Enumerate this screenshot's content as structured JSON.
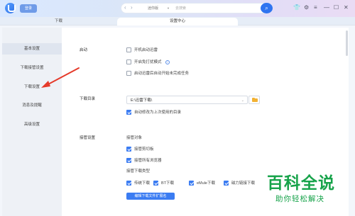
{
  "titlebar": {
    "login_label": "登录",
    "nav_back": "‹",
    "nav_forward": "›",
    "search_tag": "迷你版",
    "search_placeholder": "去搜索",
    "search_icon": "search-icon",
    "window_buttons": [
      "👕",
      "⚙",
      "≡",
      "—",
      "☐",
      "✕"
    ]
  },
  "tabs": {
    "download": "下载",
    "settings": "设置中心"
  },
  "sidebar": {
    "items": [
      {
        "label": "基本设置",
        "active": true
      },
      {
        "label": "下载接管设置",
        "active": false
      },
      {
        "label": "下载设置",
        "active": false
      },
      {
        "label": "消息及提醒",
        "active": false
      },
      {
        "label": "高级设置",
        "active": false
      }
    ]
  },
  "startup": {
    "label": "启动",
    "options": [
      {
        "text": "开机启动迅雷",
        "checked": false
      },
      {
        "text": "开启免打扰模式",
        "checked": false,
        "info_icon": "info-icon"
      },
      {
        "text": "启动迅雷后自动开始未完成任务",
        "checked": false
      }
    ]
  },
  "download_dir": {
    "label": "下载目录",
    "value": "E:\\迅雷下载\\",
    "caret": "⌄",
    "folder_icon": "folder-icon",
    "auto_modify_text": "自动修改为上次使用的目录",
    "auto_modify_checked": true
  },
  "takeover": {
    "label": "接管设置",
    "object_label": "接管对象",
    "objects": [
      {
        "text": "接管剪切板",
        "checked": true
      },
      {
        "text": "接管所有浏览器",
        "checked": true
      }
    ],
    "type_label": "接管下载类型",
    "types": [
      {
        "text": "传统下载",
        "checked": true
      },
      {
        "text": "BT下载",
        "checked": true
      },
      {
        "text": "eMule下载",
        "checked": true
      },
      {
        "text": "磁力链接下载",
        "checked": true
      }
    ],
    "extension_button": "编辑下载文件扩展名"
  },
  "watermark": {
    "title": "百科全说",
    "subtitle": "助你轻松解决"
  },
  "colors": {
    "accent": "#3b7cf2",
    "annotation_arrow": "#e53a2a",
    "watermark": "#17a34a"
  }
}
